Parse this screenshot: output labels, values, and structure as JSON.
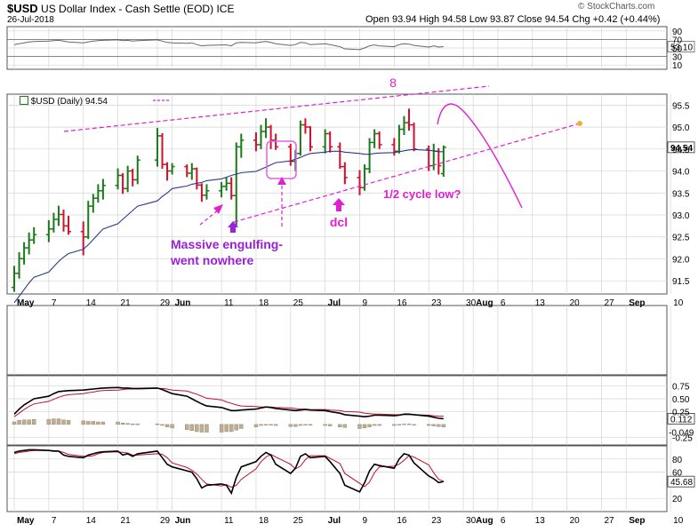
{
  "header": {
    "symbol": "$USD",
    "name": "US Dollar Index - Cash Settle (EOD)",
    "exchange": "ICE",
    "date": "26-Jul-2018",
    "ohlc": "Open 93.94  High 94.58  Low 93.87  Close 94.54  Chg +0.42 (+0.44%)",
    "brand": "© StockCharts.com",
    "price_legend": "$USD (Daily) 94.54"
  },
  "x_axis_labels": [
    "May",
    "7",
    "14",
    "21",
    "29",
    "Jun",
    "11",
    "18",
    "25",
    "Jul",
    "9",
    "16",
    "23",
    "30",
    "Aug",
    "6",
    "13",
    "20",
    "27",
    "Sep",
    "10"
  ],
  "rsi_panel": {
    "ticks": [
      "90",
      "70",
      "50",
      "30",
      "10"
    ],
    "last": "53.10"
  },
  "price_panel": {
    "ticks": [
      "95.5",
      "95.0",
      "94.5",
      "94.0",
      "93.5",
      "93.0",
      "92.5",
      "92.0",
      "91.5"
    ],
    "last": "94.54"
  },
  "macd_panel": {
    "ticks": [
      "0.75",
      "0.50",
      "0.25",
      "-0.25"
    ],
    "last_line": "0.112",
    "last_hist": "-0.049"
  },
  "sto_panel": {
    "ticks": [
      "80",
      "60",
      "20"
    ],
    "last": "45.68"
  },
  "annotations": {
    "cycle_number": "8",
    "engulfing": "Massive engulfing-\nwent nowhere",
    "dcl": "dcl",
    "half_cycle": "1/2 cycle low?"
  },
  "colors": {
    "up_bar": "#1a7a1a",
    "down_bar": "#d0102c",
    "ma": "#2a3a8c",
    "annotation": "#e020d0",
    "engulfing_text": "#9a20d8",
    "macd_line": "#000000",
    "signal_line": "#c0102c",
    "histogram": "#bfae92",
    "grid": "#d4d4d4"
  },
  "chart_data": {
    "type": "ohlc",
    "title": "$USD US Dollar Index - Cash Settle (EOD)",
    "price": [
      {
        "date": "2018-04-30",
        "open": 91.35,
        "high": 91.84,
        "low": 91.25,
        "close": 91.67
      },
      {
        "date": "2018-05-01",
        "open": 91.67,
        "high": 92.15,
        "low": 91.55,
        "close": 92.01
      },
      {
        "date": "2018-05-02",
        "open": 92.0,
        "high": 92.38,
        "low": 91.87,
        "close": 92.25
      },
      {
        "date": "2018-05-03",
        "open": 92.25,
        "high": 92.6,
        "low": 92.1,
        "close": 92.43
      },
      {
        "date": "2018-05-04",
        "open": 92.43,
        "high": 92.72,
        "low": 92.34,
        "close": 92.55
      },
      {
        "date": "2018-05-07",
        "open": 92.55,
        "high": 92.88,
        "low": 92.38,
        "close": 92.68
      },
      {
        "date": "2018-05-08",
        "open": 92.68,
        "high": 93.05,
        "low": 92.6,
        "close": 92.9
      },
      {
        "date": "2018-05-09",
        "open": 92.9,
        "high": 93.21,
        "low": 92.75,
        "close": 93.01
      },
      {
        "date": "2018-05-10",
        "open": 93.01,
        "high": 93.12,
        "low": 92.62,
        "close": 92.75
      },
      {
        "date": "2018-05-11",
        "open": 92.75,
        "high": 92.98,
        "low": 92.55,
        "close": 92.62
      },
      {
        "date": "2018-05-14",
        "open": 92.62,
        "high": 92.85,
        "low": 92.08,
        "close": 92.5
      },
      {
        "date": "2018-05-15",
        "open": 92.5,
        "high": 93.32,
        "low": 92.45,
        "close": 93.2
      },
      {
        "date": "2018-05-16",
        "open": 93.2,
        "high": 93.48,
        "low": 93.05,
        "close": 93.38
      },
      {
        "date": "2018-05-17",
        "open": 93.38,
        "high": 93.7,
        "low": 93.28,
        "close": 93.55
      },
      {
        "date": "2018-05-18",
        "open": 93.55,
        "high": 93.82,
        "low": 93.35,
        "close": 93.67
      },
      {
        "date": "2018-05-21",
        "open": 93.67,
        "high": 94.06,
        "low": 93.58,
        "close": 93.9
      },
      {
        "date": "2018-05-22",
        "open": 93.9,
        "high": 93.95,
        "low": 93.48,
        "close": 93.6
      },
      {
        "date": "2018-05-23",
        "open": 93.6,
        "high": 94.12,
        "low": 93.52,
        "close": 94.0
      },
      {
        "date": "2018-05-24",
        "open": 94.0,
        "high": 94.05,
        "low": 93.65,
        "close": 93.8
      },
      {
        "date": "2018-05-25",
        "open": 93.8,
        "high": 94.35,
        "low": 93.7,
        "close": 94.25
      },
      {
        "date": "2018-05-29",
        "open": 94.25,
        "high": 94.98,
        "low": 94.1,
        "close": 94.8
      },
      {
        "date": "2018-05-30",
        "open": 94.8,
        "high": 94.86,
        "low": 94.05,
        "close": 94.15
      },
      {
        "date": "2018-05-31",
        "open": 94.15,
        "high": 94.2,
        "low": 93.78,
        "close": 94.0
      },
      {
        "date": "2018-06-01",
        "open": 94.0,
        "high": 94.18,
        "low": 93.92,
        "close": 94.1
      },
      {
        "date": "2018-06-04",
        "open": 94.1,
        "high": 94.15,
        "low": 93.86,
        "close": 93.95
      },
      {
        "date": "2018-06-05",
        "open": 93.95,
        "high": 94.18,
        "low": 93.8,
        "close": 94.05
      },
      {
        "date": "2018-06-06",
        "open": 94.05,
        "high": 94.08,
        "low": 93.58,
        "close": 93.68
      },
      {
        "date": "2018-06-07",
        "open": 93.68,
        "high": 93.72,
        "low": 93.3,
        "close": 93.45
      },
      {
        "date": "2018-06-08",
        "open": 93.45,
        "high": 93.7,
        "low": 93.35,
        "close": 93.55
      },
      {
        "date": "2018-06-11",
        "open": 93.55,
        "high": 93.75,
        "low": 93.4,
        "close": 93.65
      },
      {
        "date": "2018-06-12",
        "open": 93.65,
        "high": 93.85,
        "low": 93.55,
        "close": 93.72
      },
      {
        "date": "2018-06-13",
        "open": 93.72,
        "high": 93.86,
        "low": 93.35,
        "close": 93.44
      },
      {
        "date": "2018-06-14",
        "open": 93.44,
        "high": 94.65,
        "low": 92.75,
        "close": 94.55
      },
      {
        "date": "2018-06-15",
        "open": 94.55,
        "high": 94.85,
        "low": 94.3,
        "close": 94.7
      },
      {
        "date": "2018-06-18",
        "open": 94.7,
        "high": 94.88,
        "low": 94.45,
        "close": 94.6
      },
      {
        "date": "2018-06-19",
        "open": 94.6,
        "high": 95.05,
        "low": 94.5,
        "close": 94.9
      },
      {
        "date": "2018-06-20",
        "open": 94.9,
        "high": 95.2,
        "low": 94.75,
        "close": 95.0
      },
      {
        "date": "2018-06-21",
        "open": 95.0,
        "high": 95.05,
        "low": 94.5,
        "close": 94.7
      },
      {
        "date": "2018-06-22",
        "open": 94.7,
        "high": 94.85,
        "low": 94.48,
        "close": 94.55
      },
      {
        "date": "2018-06-25",
        "open": 94.55,
        "high": 94.62,
        "low": 94.12,
        "close": 94.22
      },
      {
        "date": "2018-06-26",
        "open": 94.22,
        "high": 94.48,
        "low": 94.0,
        "close": 94.4
      },
      {
        "date": "2018-06-27",
        "open": 94.4,
        "high": 95.15,
        "low": 94.35,
        "close": 95.05
      },
      {
        "date": "2018-06-28",
        "open": 95.05,
        "high": 95.2,
        "low": 94.85,
        "close": 95.0
      },
      {
        "date": "2018-06-29",
        "open": 95.0,
        "high": 95.02,
        "low": 94.45,
        "close": 94.55
      },
      {
        "date": "2018-07-02",
        "open": 94.55,
        "high": 94.95,
        "low": 94.4,
        "close": 94.85
      },
      {
        "date": "2018-07-03",
        "open": 94.85,
        "high": 94.9,
        "low": 94.42,
        "close": 94.55
      },
      {
        "date": "2018-07-05",
        "open": 94.55,
        "high": 94.65,
        "low": 94.05,
        "close": 94.1
      },
      {
        "date": "2018-07-06",
        "open": 94.1,
        "high": 94.2,
        "low": 93.7,
        "close": 93.85
      },
      {
        "date": "2018-07-09",
        "open": 93.85,
        "high": 94.02,
        "low": 93.45,
        "close": 93.62
      },
      {
        "date": "2018-07-10",
        "open": 93.62,
        "high": 94.15,
        "low": 93.55,
        "close": 94.05
      },
      {
        "date": "2018-07-11",
        "open": 94.05,
        "high": 94.75,
        "low": 93.95,
        "close": 94.65
      },
      {
        "date": "2018-07-12",
        "open": 94.65,
        "high": 94.95,
        "low": 94.52,
        "close": 94.85
      },
      {
        "date": "2018-07-13",
        "open": 94.85,
        "high": 94.9,
        "low": 94.5,
        "close": 94.6
      },
      {
        "date": "2018-07-16",
        "open": 94.6,
        "high": 94.75,
        "low": 94.35,
        "close": 94.45
      },
      {
        "date": "2018-07-17",
        "open": 94.45,
        "high": 95.05,
        "low": 94.4,
        "close": 94.95
      },
      {
        "date": "2018-07-18",
        "open": 94.95,
        "high": 95.25,
        "low": 94.82,
        "close": 95.1
      },
      {
        "date": "2018-07-19",
        "open": 95.1,
        "high": 95.42,
        "low": 94.92,
        "close": 95.05
      },
      {
        "date": "2018-07-20",
        "open": 95.05,
        "high": 95.1,
        "low": 94.45,
        "close": 94.5
      },
      {
        "date": "2018-07-23",
        "open": 94.5,
        "high": 94.58,
        "low": 94.0,
        "close": 94.12
      },
      {
        "date": "2018-07-24",
        "open": 94.12,
        "high": 94.62,
        "low": 94.02,
        "close": 94.45
      },
      {
        "date": "2018-07-25",
        "open": 94.45,
        "high": 94.52,
        "low": 93.92,
        "close": 94.12
      },
      {
        "date": "2018-07-26",
        "open": 93.94,
        "high": 94.58,
        "low": 93.87,
        "close": 94.54
      }
    ],
    "ma": [
      91.0,
      91.15,
      91.3,
      91.45,
      91.58,
      91.7,
      91.82,
      91.94,
      92.04,
      92.12,
      92.22,
      92.32,
      92.44,
      92.56,
      92.68,
      92.8,
      92.9,
      93.0,
      93.1,
      93.2,
      93.32,
      93.42,
      93.5,
      93.6,
      93.66,
      93.7,
      93.72,
      93.74,
      93.78,
      93.82,
      93.86,
      93.9,
      93.93,
      93.96,
      93.99,
      94.04,
      94.09,
      94.14,
      94.19,
      94.23,
      94.27,
      94.31,
      94.36,
      94.4,
      94.43,
      94.45,
      94.45,
      94.43,
      94.4,
      94.38,
      94.38,
      94.4,
      94.41,
      94.42,
      94.44,
      94.46,
      94.48,
      94.49,
      94.47,
      94.46,
      94.44,
      94.44
    ],
    "ylim": [
      91.2,
      95.75
    ],
    "x_range": [
      "2018-04-30",
      "2018-09-14"
    ],
    "rsi": {
      "ylim": [
        0,
        100
      ],
      "values": [
        58,
        60,
        62,
        64,
        65,
        66,
        67,
        68,
        66,
        64,
        62,
        64,
        66,
        67,
        68,
        69,
        67,
        68,
        66,
        67,
        69,
        66,
        63,
        62,
        61,
        62,
        58,
        55,
        56,
        57,
        57,
        55,
        62,
        63,
        62,
        64,
        65,
        63,
        60,
        56,
        58,
        63,
        62,
        58,
        60,
        58,
        53,
        48,
        46,
        50,
        55,
        57,
        55,
        53,
        58,
        60,
        59,
        56,
        52,
        55,
        52,
        53.1
      ]
    },
    "macd": {
      "ylim": [
        -0.4,
        0.95
      ],
      "line": [
        0.2,
        0.3,
        0.38,
        0.44,
        0.5,
        0.55,
        0.6,
        0.64,
        0.65,
        0.66,
        0.67,
        0.68,
        0.69,
        0.7,
        0.71,
        0.72,
        0.71,
        0.71,
        0.7,
        0.7,
        0.71,
        0.68,
        0.64,
        0.6,
        0.55,
        0.5,
        0.45,
        0.4,
        0.36,
        0.33,
        0.3,
        0.27,
        0.27,
        0.28,
        0.3,
        0.32,
        0.34,
        0.33,
        0.31,
        0.28,
        0.27,
        0.28,
        0.29,
        0.28,
        0.27,
        0.25,
        0.22,
        0.19,
        0.16,
        0.15,
        0.16,
        0.18,
        0.18,
        0.17,
        0.18,
        0.2,
        0.2,
        0.19,
        0.16,
        0.14,
        0.12,
        0.112
      ],
      "signal": [
        0.15,
        0.22,
        0.29,
        0.35,
        0.4,
        0.45,
        0.49,
        0.53,
        0.56,
        0.58,
        0.6,
        0.62,
        0.63,
        0.65,
        0.66,
        0.67,
        0.68,
        0.69,
        0.69,
        0.69,
        0.7,
        0.7,
        0.69,
        0.67,
        0.65,
        0.62,
        0.59,
        0.55,
        0.51,
        0.48,
        0.44,
        0.41,
        0.38,
        0.36,
        0.35,
        0.34,
        0.34,
        0.34,
        0.33,
        0.32,
        0.31,
        0.3,
        0.3,
        0.29,
        0.29,
        0.28,
        0.27,
        0.25,
        0.24,
        0.22,
        0.21,
        0.2,
        0.2,
        0.19,
        0.19,
        0.19,
        0.19,
        0.19,
        0.18,
        0.17,
        0.16,
        0.161
      ],
      "histogram": [
        0.05,
        0.08,
        0.09,
        0.09,
        0.1,
        0.1,
        0.11,
        0.11,
        0.09,
        0.08,
        0.07,
        0.06,
        0.06,
        0.05,
        0.05,
        0.05,
        0.03,
        0.02,
        0.01,
        0.01,
        0.01,
        -0.02,
        -0.05,
        -0.07,
        -0.1,
        -0.12,
        -0.14,
        -0.15,
        -0.15,
        -0.15,
        -0.14,
        -0.14,
        -0.11,
        -0.08,
        -0.05,
        -0.02,
        0.0,
        -0.01,
        -0.02,
        -0.04,
        -0.04,
        -0.02,
        -0.01,
        -0.01,
        -0.02,
        -0.03,
        -0.05,
        -0.06,
        -0.08,
        -0.07,
        -0.05,
        -0.02,
        -0.02,
        -0.02,
        -0.01,
        0.01,
        0.01,
        0.0,
        -0.02,
        -0.03,
        -0.04,
        -0.049
      ]
    },
    "stochastic": {
      "ylim": [
        0,
        100
      ],
      "k": [
        90,
        92,
        93,
        94,
        94,
        93,
        92,
        92,
        86,
        84,
        82,
        86,
        88,
        90,
        91,
        92,
        86,
        88,
        84,
        88,
        92,
        82,
        72,
        68,
        62,
        60,
        50,
        36,
        40,
        42,
        40,
        28,
        52,
        68,
        76,
        84,
        90,
        86,
        72,
        58,
        66,
        84,
        88,
        82,
        84,
        76,
        58,
        40,
        30,
        44,
        62,
        72,
        70,
        66,
        80,
        88,
        86,
        74,
        54,
        50,
        44,
        45.68
      ],
      "d": [
        88,
        90,
        91,
        92,
        93,
        93,
        93,
        92,
        90,
        87,
        84,
        84,
        85,
        88,
        90,
        91,
        90,
        89,
        86,
        86,
        88,
        87,
        82,
        74,
        67,
        63,
        57,
        49,
        42,
        39,
        41,
        37,
        40,
        49,
        65,
        76,
        83,
        87,
        83,
        72,
        65,
        69,
        79,
        85,
        85,
        81,
        73,
        58,
        43,
        38,
        45,
        59,
        68,
        69,
        72,
        78,
        85,
        83,
        71,
        59,
        49,
        46
      ]
    }
  }
}
